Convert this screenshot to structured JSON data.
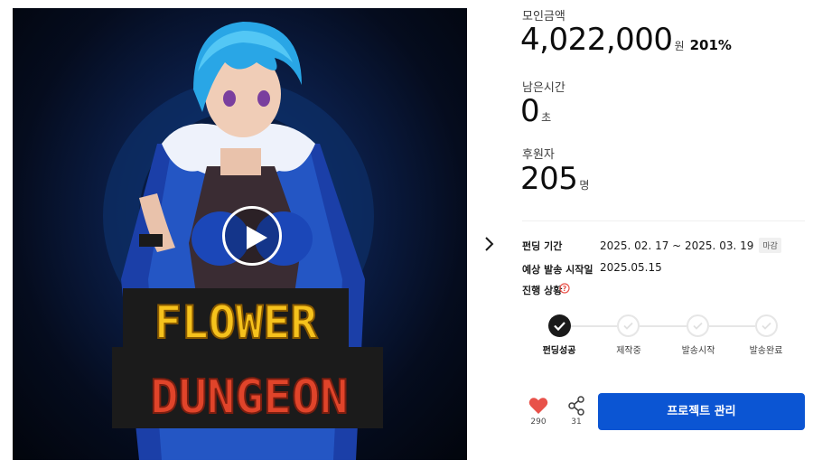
{
  "media": {
    "logo_line1": "FLOWER",
    "logo_line2": "DUNGEON",
    "play_icon": "play-icon"
  },
  "stats": {
    "funding": {
      "label": "모인금액",
      "value": "4,022,000",
      "unit": "원",
      "rate": "201%"
    },
    "time_left": {
      "label": "남은시간",
      "value": "0",
      "unit": "초"
    },
    "backers": {
      "label": "후원자",
      "value": "205",
      "unit": "명"
    }
  },
  "info": {
    "period": {
      "label": "펀딩 기간",
      "value": "2025. 02. 17 ~ 2025. 03. 19",
      "badge": "마감"
    },
    "ship_start": {
      "label": "예상 발송 시작일",
      "value": "2025.05.15"
    },
    "progress": {
      "label": "진행 상황"
    }
  },
  "stepper": {
    "steps": [
      {
        "label": "펀딩성공",
        "done": true
      },
      {
        "label": "제작중",
        "done": false
      },
      {
        "label": "발송시작",
        "done": false
      },
      {
        "label": "발송완료",
        "done": false
      }
    ]
  },
  "actions": {
    "like_count": "290",
    "share_count": "31",
    "manage_label": "프로젝트 관리"
  },
  "colors": {
    "primary_button": "#0b55d3",
    "like": "#e8524a",
    "step_done": "#1a1a1a",
    "step_todo": "#e6e6e6"
  }
}
